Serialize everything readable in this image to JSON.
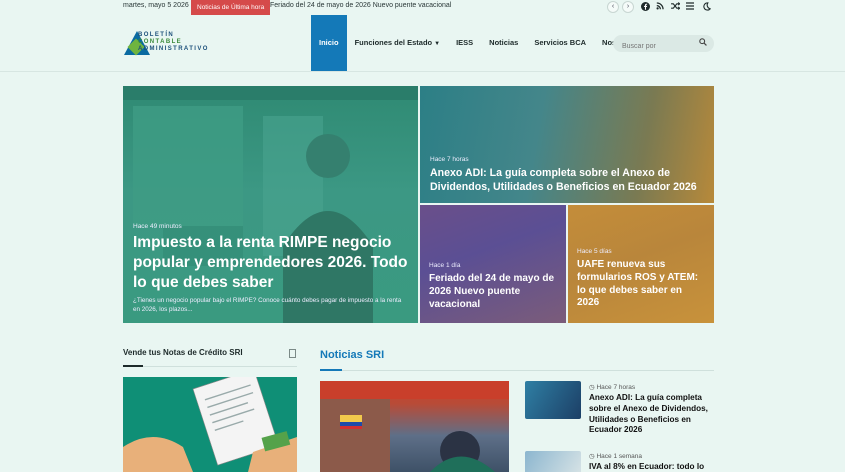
{
  "topbar": {
    "date": "martes, mayo 5 2026",
    "breaking_label": "Noticias de Última hora",
    "ticker_text": "Feriado del 24 de mayo de 2026 Nuevo puente vacacional",
    "icons": [
      "chevron-left-icon",
      "chevron-right-icon",
      "facebook-icon",
      "rss-icon",
      "shuffle-icon",
      "menu-icon",
      "moon-icon"
    ]
  },
  "logo": {
    "line1": "BOLETÍN",
    "line2": "CONTABLE",
    "line3": "ADMINISTRATIVO"
  },
  "nav": {
    "items": [
      {
        "label": "Inicio"
      },
      {
        "label": "Funciones del Estado"
      },
      {
        "label": "IESS"
      },
      {
        "label": "Noticias"
      },
      {
        "label": "Servicios BCA"
      },
      {
        "label": "Nosotros"
      }
    ],
    "search_placeholder": "Buscar por"
  },
  "hero": {
    "main": {
      "meta": "Hace 49 minutos",
      "title": "Impuesto a la renta RIMPE negocio popular y emprendedores 2026. Todo lo que debes saber",
      "excerpt": "¿Tienes un negocio popular bajo el RIMPE? Conoce cuánto debes pagar de impuesto a la renta en 2026, los plazos..."
    },
    "top_right": {
      "meta": "Hace 7 horas",
      "title": "Anexo ADI: La guía completa sobre el Anexo de Dividendos, Utilidades o Beneficios en Ecuador 2026"
    },
    "bottom_left": {
      "meta": "Hace 1 día",
      "title": "Feriado del 24 de mayo de 2026 Nuevo puente vacacional"
    },
    "bottom_right": {
      "meta": "Hace 5 días",
      "title": "UAFE renueva sus formularios ROS y ATEM: lo que debes saber en 2026"
    }
  },
  "sidebar": {
    "heading": "Vende tus Notas de Crédito SRI"
  },
  "news": {
    "heading": "Noticias SRI",
    "items": [
      {
        "meta": "Hace 7 horas",
        "title": "Anexo ADI: La guía completa sobre el Anexo de Dividendos, Utilidades o Beneficios en Ecuador 2026"
      },
      {
        "meta": "Hace 1 semana",
        "title": "IVA al 8% en Ecuador: todo lo"
      }
    ]
  },
  "colors": {
    "accent": "#1479b8",
    "breaking": "#d54a4a",
    "background": "#e9f6f2"
  }
}
